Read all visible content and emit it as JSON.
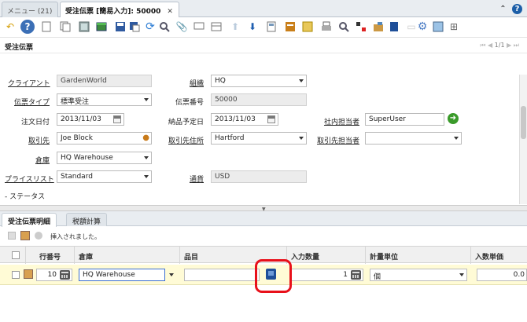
{
  "tabs": [
    {
      "label": "メニュー (21)"
    },
    {
      "label": "受注伝票 [簡易入力]: 50000",
      "close": "✕"
    }
  ],
  "window_title": "受注伝票",
  "pagination": "1/1",
  "form": {
    "client_label": "クライアント",
    "client_value": "GardenWorld",
    "org_label": "組織",
    "org_value": "HQ",
    "doctype_label": "伝票タイプ",
    "doctype_value": "標準受注",
    "docno_label": "伝票番号",
    "docno_value": "50000",
    "orderdate_label": "注文日付",
    "orderdate_value": "2013/11/03",
    "promised_label": "納品予定日",
    "promised_value": "2013/11/03",
    "salesrep_label": "社内担当者",
    "salesrep_value": "SuperUser",
    "bpartner_label": "取引先",
    "bpartner_value": "Joe Block",
    "bplocation_label": "取引先住所",
    "bplocation_value": "Hartford",
    "bpcontact_label": "取引先担当者",
    "bpcontact_value": "",
    "warehouse_label": "倉庫",
    "warehouse_value": "HQ Warehouse",
    "pricelist_label": "プライスリスト",
    "pricelist_value": "Standard",
    "currency_label": "通貨",
    "currency_value": "USD",
    "status_label": "- ステータス"
  },
  "detail_tabs": [
    {
      "label": "受注伝票明細"
    },
    {
      "label": "税額計算"
    }
  ],
  "detail_status": "挿入されました。",
  "grid": {
    "columns": [
      "行番号",
      "倉庫",
      "品目",
      "入力数量",
      "計量単位",
      "入数単価"
    ],
    "row": {
      "line": "10",
      "warehouse": "HQ Warehouse",
      "product": "",
      "qty": "1",
      "uom": "個",
      "price": "0.0"
    }
  },
  "colors": {
    "accent": "#e8101a",
    "row_highlight": "#fffbd6"
  }
}
